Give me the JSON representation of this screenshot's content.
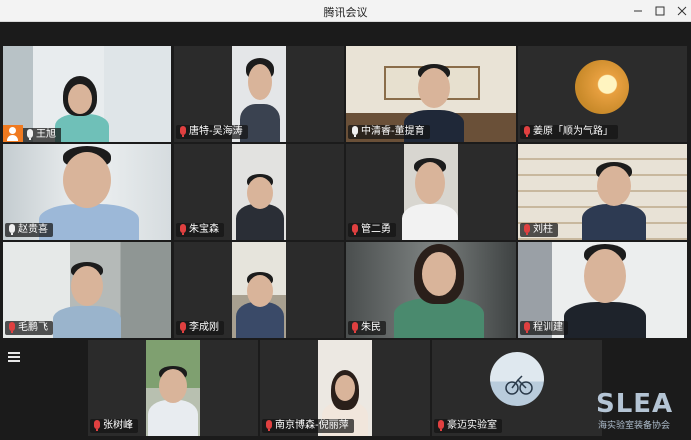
{
  "window": {
    "title": "腾讯会议"
  },
  "participants": [
    {
      "name": "王旭",
      "mic": "on",
      "host": true
    },
    {
      "name": "唐特-吴海涛",
      "mic": "muted"
    },
    {
      "name": "中清睿-董提育",
      "mic": "on"
    },
    {
      "name": "姜原「顺为气路」",
      "mic": "muted"
    },
    {
      "name": "赵贵喜",
      "mic": "on"
    },
    {
      "name": "朱宝森",
      "mic": "muted"
    },
    {
      "name": "管二勇",
      "mic": "muted"
    },
    {
      "name": "刘柱",
      "mic": "muted"
    },
    {
      "name": "毛鹏飞",
      "mic": "muted"
    },
    {
      "name": "李成刚",
      "mic": "muted"
    },
    {
      "name": "朱民",
      "mic": "muted"
    },
    {
      "name": "程训建",
      "mic": "muted"
    },
    {
      "name": "张树峰",
      "mic": "muted"
    },
    {
      "name": "南京博森-倪丽萍",
      "mic": "muted"
    },
    {
      "name": "豪迈实验室",
      "mic": "muted"
    }
  ],
  "logo": {
    "text": "SLEA",
    "subtitle": "海实验室装备协会"
  },
  "colors": {
    "host_badge": "#f07a20",
    "muted_mic": "#e04040",
    "background": "#1b1b1b"
  }
}
